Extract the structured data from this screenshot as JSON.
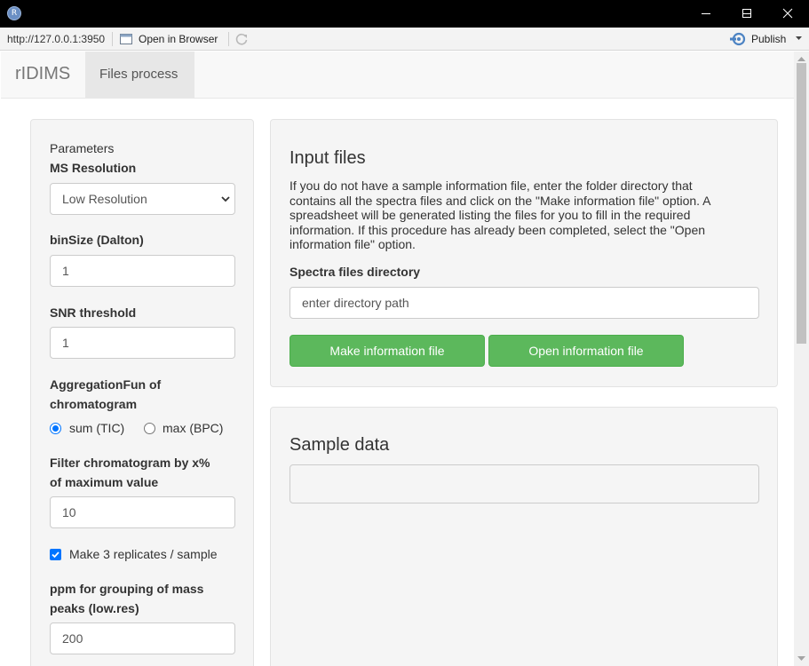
{
  "window": {
    "app_icon_letter": "R",
    "minimize_icon": "minimize-icon",
    "maximize_icon": "maximize-icon",
    "close_icon": "close-icon"
  },
  "toolbar": {
    "url": "http://127.0.0.1:3950",
    "open_in_browser": "Open in Browser",
    "publish": "Publish"
  },
  "navbar": {
    "brand": "rIDIMS",
    "tab": "Files process"
  },
  "sidebar": {
    "parameters_title": "Parameters",
    "ms_resolution_label": "MS Resolution",
    "ms_resolution_value": "Low Resolution",
    "binsize_label": "binSize (Dalton)",
    "binsize_value": "1",
    "snr_label": "SNR threshold",
    "snr_value": "1",
    "aggregation_label_1": "AggregationFun of",
    "aggregation_label_2": "chromatogram",
    "aggregation_option_sum": "sum (TIC)",
    "aggregation_option_max": "max (BPC)",
    "aggregation_selected": "sum (TIC)",
    "filter_label_1": "Filter chromatogram by x%",
    "filter_label_2": "of maximum value",
    "filter_value": "10",
    "replicates_label": "Make 3 replicates / sample",
    "replicates_checked": true,
    "ppm_label_1": "ppm for grouping of mass",
    "ppm_label_2": "peaks (low.res)",
    "ppm_value": "200"
  },
  "input_files": {
    "title": "Input files",
    "description_lines": [
      "If you do not have a sample information file, enter the folder directory that",
      "contains all the spectra files and click on the \"Make information file\" option. A",
      "spreadsheet will be generated listing the files for you to fill in the required",
      "information. If this procedure has already been completed, select the \"Open",
      "information file\" option."
    ],
    "directory_label": "Spectra files directory",
    "directory_placeholder": "enter directory path",
    "make_button": "Make information file",
    "open_button": "Open information file"
  },
  "sample_data": {
    "title": "Sample data",
    "value": ""
  },
  "colors": {
    "button_green": "#5cb85c",
    "well_background": "#f5f5f5",
    "checkbox_blue": "#0075ff"
  }
}
